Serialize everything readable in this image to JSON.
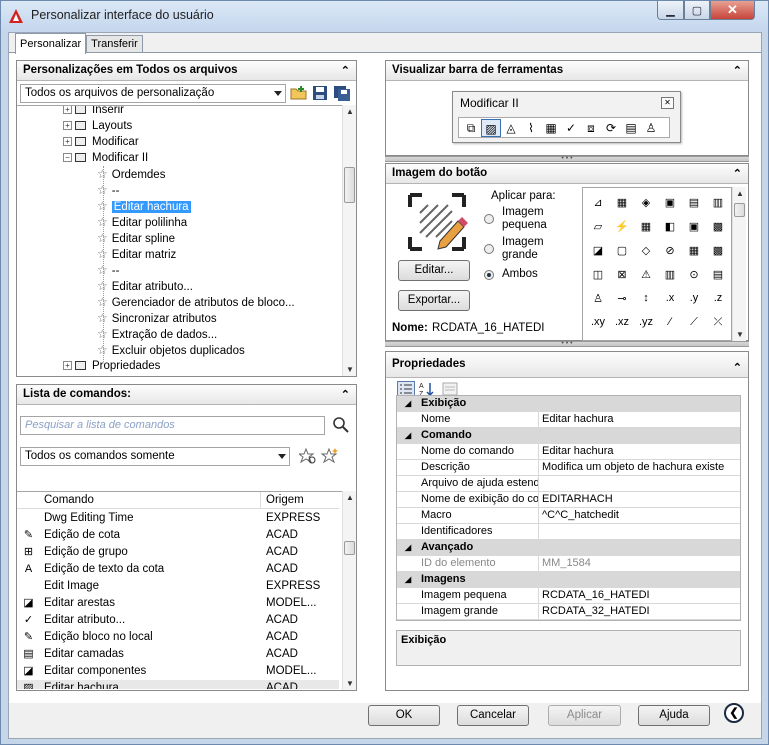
{
  "window": {
    "title": "Personalizar interface do usuário",
    "minimize_label": "▁",
    "maximize_label": "▢",
    "close_label": "✕"
  },
  "tabs": [
    "Personalizar",
    "Transferir"
  ],
  "customizations_panel": {
    "title": "Personalizações em Todos os arquivos",
    "collapse_label": "⌃",
    "filter_value": "Todos os arquivos de personalização",
    "tree": [
      {
        "label": "Inserir",
        "kind": "toolbar",
        "expander": "+"
      },
      {
        "label": "Layouts",
        "kind": "toolbar",
        "expander": "+"
      },
      {
        "label": "Modificar",
        "kind": "toolbar",
        "expander": "+"
      },
      {
        "label": "Modificar II",
        "kind": "toolbar",
        "expander": "−"
      },
      {
        "label": "Ordemdes",
        "kind": "command"
      },
      {
        "label": "--",
        "kind": "command"
      },
      {
        "label": "Editar hachura",
        "kind": "command",
        "selected": true
      },
      {
        "label": "Editar polilinha",
        "kind": "command"
      },
      {
        "label": "Editar spline",
        "kind": "command"
      },
      {
        "label": "Editar matriz",
        "kind": "command"
      },
      {
        "label": "--",
        "kind": "command"
      },
      {
        "label": "Editar atributo...",
        "kind": "command"
      },
      {
        "label": "Gerenciador de atributos de bloco...",
        "kind": "command"
      },
      {
        "label": "Sincronizar atributos",
        "kind": "command"
      },
      {
        "label": "Extração de dados...",
        "kind": "command"
      },
      {
        "label": "Excluir objetos duplicados",
        "kind": "command"
      },
      {
        "label": "Propriedades",
        "kind": "toolbar",
        "expander": "+"
      }
    ]
  },
  "commands_panel": {
    "title": "Lista de comandos:",
    "collapse_label": "⌃",
    "search_placeholder": "Pesquisar a lista de comandos",
    "filter_value": "Todos os comandos somente",
    "columns": [
      "Comando",
      "Origem"
    ],
    "rows": [
      {
        "name": "Dwg Editing Time",
        "origin": "EXPRESS",
        "icon": ""
      },
      {
        "name": "Edição de cota",
        "origin": "ACAD",
        "icon": "✎"
      },
      {
        "name": "Edição de grupo",
        "origin": "ACAD",
        "icon": "⊞"
      },
      {
        "name": "Edição de texto da cota",
        "origin": "ACAD",
        "icon": "A"
      },
      {
        "name": "Edit Image",
        "origin": "EXPRESS",
        "icon": ""
      },
      {
        "name": "Editar arestas",
        "origin": "MODEL...",
        "icon": "◪"
      },
      {
        "name": "Editar atributo...",
        "origin": "ACAD",
        "icon": "✓"
      },
      {
        "name": "Edição bloco no local",
        "origin": "ACAD",
        "icon": "✎"
      },
      {
        "name": "Editar camadas",
        "origin": "ACAD",
        "icon": "▤"
      },
      {
        "name": "Editar componentes",
        "origin": "MODEL...",
        "icon": "◪"
      },
      {
        "name": "Editar hachura",
        "origin": "ACAD",
        "icon": "▨"
      }
    ]
  },
  "toolbar_preview_panel": {
    "title": "Visualizar barra de ferramentas",
    "collapse_label": "⌃",
    "toolbar_title": "Modificar II",
    "toolbar_icons": [
      "draworder-icon",
      "edit-hatch-icon",
      "edit-polyline-icon",
      "edit-spline-icon",
      "edit-array-icon",
      "edit-attribute-icon",
      "block-attribute-manager-icon",
      "sync-attributes-icon",
      "data-extraction-icon",
      "delete-duplicates-icon"
    ]
  },
  "button_image_panel": {
    "title": "Imagem do botão",
    "collapse_label": "⌃",
    "apply_to_label": "Aplicar para:",
    "options": [
      "Imagem pequena",
      "Imagem grande",
      "Ambos"
    ],
    "selected_option": "Ambos",
    "edit_button": "Editar...",
    "export_button": "Exportar...",
    "name_label": "Nome:",
    "name_value": "RCDATA_16_HATEDI",
    "grid_icons": [
      "⊿",
      "▦",
      "◈",
      "▣",
      "▤",
      "▥",
      "▱",
      "⚡",
      "▦",
      "◧",
      "▣",
      "▩",
      "◪",
      "▢",
      "◇",
      "⊘",
      "▦",
      "▩",
      "◫",
      "⊠",
      "⚠",
      "▥",
      "⊙",
      "▤",
      "♙",
      "⊸",
      "↕",
      ".x",
      ".y",
      ".z",
      ".xy",
      ".xz",
      ".yz",
      "⁄",
      "⟋",
      "⤫",
      "—"
    ]
  },
  "properties_panel": {
    "title": "Propriedades",
    "collapse_label": "⌃",
    "categories": [
      {
        "name": "Exibição",
        "rows": [
          {
            "key": "Nome",
            "value": "Editar hachura"
          }
        ]
      },
      {
        "name": "Comando",
        "rows": [
          {
            "key": "Nome do comando",
            "value": "Editar hachura"
          },
          {
            "key": "Descrição",
            "value": "Modifica um objeto de hachura existe"
          },
          {
            "key": "Arquivo de ajuda estendida",
            "value": ""
          },
          {
            "key": "Nome de exibição do comar",
            "value": "EDITARHACH"
          },
          {
            "key": "Macro",
            "value": "^C^C_hatchedit"
          },
          {
            "key": "Identificadores",
            "value": ""
          }
        ]
      },
      {
        "name": "Avançado",
        "rows": [
          {
            "key": "ID do elemento",
            "value": "MM_1584",
            "muted": true
          }
        ]
      },
      {
        "name": "Imagens",
        "rows": [
          {
            "key": "Imagem pequena",
            "value": "RCDATA_16_HATEDI"
          },
          {
            "key": "Imagem grande",
            "value": "RCDATA_32_HATEDI"
          }
        ]
      }
    ],
    "description_title": "Exibição"
  },
  "footer": {
    "ok": "OK",
    "cancel": "Cancelar",
    "apply": "Aplicar",
    "help": "Ajuda",
    "toggle": "❮"
  }
}
